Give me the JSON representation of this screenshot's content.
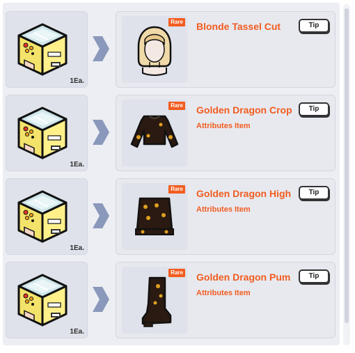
{
  "rows": [
    {
      "quantity": "1Ea.",
      "rarity": "Rare",
      "item_name": "Blonde Tassel Cut",
      "item_subtitle": "",
      "tip_label": "Tip",
      "item_icon": "blonde-wig-icon"
    },
    {
      "quantity": "1Ea.",
      "rarity": "Rare",
      "item_name": "Golden Dragon Crop",
      "item_subtitle": "Attributes Item",
      "tip_label": "Tip",
      "item_icon": "crop-top-icon"
    },
    {
      "quantity": "1Ea.",
      "rarity": "Rare",
      "item_name": "Golden Dragon High",
      "item_subtitle": "Attributes Item",
      "tip_label": "Tip",
      "item_icon": "skirt-icon"
    },
    {
      "quantity": "1Ea.",
      "rarity": "Rare",
      "item_name": "Golden Dragon Pum",
      "item_subtitle": "Attributes Item",
      "tip_label": "Tip",
      "item_icon": "boot-icon"
    }
  ],
  "colors": {
    "accent": "#f25c1f",
    "arrow": "#8a98bb",
    "panel": "#eceef3"
  }
}
